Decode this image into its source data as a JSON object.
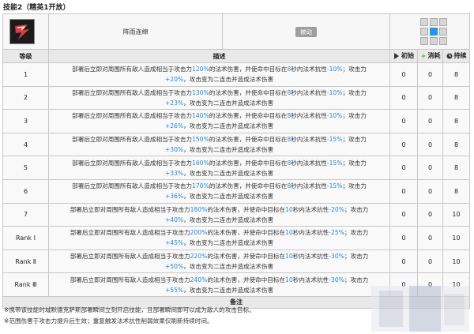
{
  "skill": {
    "heading": "技能2（精英1开放）",
    "name": "阵雨连绵",
    "type_badge": "被动",
    "icon": "skill-icon-storm"
  },
  "columns": {
    "level": "等级",
    "desc": "描述",
    "initial": "初始",
    "cost": "消耗",
    "duration": "持续"
  },
  "rows": [
    {
      "level": "1",
      "pre": "部署后立即对周围所有敌人造成相当于攻击力",
      "pct": "120%",
      "mid": "的法术伤害，并使命中目标在",
      "sec": "8",
      "post": "秒内法术抗性",
      "res": "-10%",
      "tail": "；攻击力",
      "atk": "+20%",
      "line2": "，攻击变为二连击并造成法术伤害",
      "init": "0",
      "cost": "0",
      "dur": "8"
    },
    {
      "level": "2",
      "pre": "部署后立即对周围所有敌人造成相当于攻击力",
      "pct": "130%",
      "mid": "的法术伤害，并使命中目标在",
      "sec": "8",
      "post": "秒内法术抗性",
      "res": "-10%",
      "tail": "；攻击力",
      "atk": "+23%",
      "line2": "，攻击变为二连击并造成法术伤害",
      "init": "0",
      "cost": "0",
      "dur": "8"
    },
    {
      "level": "3",
      "pre": "部署后立即对周围所有敌人造成相当于攻击力",
      "pct": "140%",
      "mid": "的法术伤害，并使命中目标在",
      "sec": "8",
      "post": "秒内法术抗性",
      "res": "-10%",
      "tail": "；攻击力",
      "atk": "+26%",
      "line2": "，攻击变为二连击并造成法术伤害",
      "init": "0",
      "cost": "0",
      "dur": "8"
    },
    {
      "level": "4",
      "pre": "部署后立即对周围所有敌人造成相当于攻击力",
      "pct": "150%",
      "mid": "的法术伤害，并使命中目标在",
      "sec": "8",
      "post": "秒内法术抗性",
      "res": "-15%",
      "tail": "；攻击力",
      "atk": "+30%",
      "line2": "，攻击变为二连击并造成法术伤害",
      "init": "0",
      "cost": "0",
      "dur": "8"
    },
    {
      "level": "5",
      "pre": "部署后立即对周围所有敌人造成相当于攻击力",
      "pct": "160%",
      "mid": "的法术伤害，并使命中目标在",
      "sec": "8",
      "post": "秒内法术抗性",
      "res": "-15%",
      "tail": "；攻击力",
      "atk": "+33%",
      "line2": "，攻击变为二连击并造成法术伤害",
      "init": "0",
      "cost": "0",
      "dur": "8"
    },
    {
      "level": "6",
      "pre": "部署后立即对周围所有敌人造成相当于攻击力",
      "pct": "170%",
      "mid": "的法术伤害，并使命中目标在",
      "sec": "8",
      "post": "秒内法术抗性",
      "res": "-15%",
      "tail": "；攻击力",
      "atk": "+36%",
      "line2": "，攻击变为二连击并造成法术伤害",
      "init": "0",
      "cost": "0",
      "dur": "8"
    },
    {
      "level": "7",
      "pre": "部署后立即对周围所有敌人造成相当于攻击力",
      "pct": "180%",
      "mid": "的法术伤害，并使命中目标在",
      "sec": "10",
      "post": "秒内法术抗性",
      "res": "-20%",
      "tail": "；攻击力",
      "atk": "+40%",
      "line2": "，攻击变为二连击并造成法术伤害",
      "init": "0",
      "cost": "0",
      "dur": "10"
    },
    {
      "level": "Rank Ⅰ",
      "pre": "部署后立即对周围所有敌人造成相当于攻击力",
      "pct": "200%",
      "mid": "的法术伤害，并使命中目标在",
      "sec": "10",
      "post": "秒内法术抗性",
      "res": "-25%",
      "tail": "；攻击力",
      "atk": "+45%",
      "line2": "，攻击变为二连击并造成法术伤害",
      "init": "0",
      "cost": "0",
      "dur": "10"
    },
    {
      "level": "Rank Ⅱ",
      "pre": "部署后立即对周围所有敌人造成相当于攻击力",
      "pct": "220%",
      "mid": "的法术伤害，并使命中目标在",
      "sec": "10",
      "post": "秒内法术抗性",
      "res": "-30%",
      "tail": "；攻击力",
      "atk": "+50%",
      "line2": "，攻击变为二连击并造成法术伤害",
      "init": "0",
      "cost": "0",
      "dur": "10"
    },
    {
      "level": "Rank Ⅲ",
      "pre": "部署后立即对周围所有敌人造成相当于攻击力",
      "pct": "240%",
      "mid": "的法术伤害，并使命中目标在",
      "sec": "10",
      "post": "秒内法术抗性",
      "res": "-30%",
      "tail": "；攻击力",
      "atk": "+55%",
      "line2": "，攻击变为二连击并造成法术伤害",
      "init": "0",
      "cost": "0",
      "dur": "10"
    }
  ],
  "notes": {
    "heading": "备注",
    "lines": [
      "※携带该技能时城默德克萨斯部署瞬间立刻开启技能，且部署瞬间即可以成为敌人的攻击目标。",
      "※范围伤害于攻击力提升后生效；重复触发法术抗性削弱效果仅刷新持续时间。"
    ]
  },
  "colors": {
    "highlight": "#1e88e5",
    "range_self": "#2196f3",
    "range_hit": "#d6d6d6",
    "badge": "#9e9e9e"
  }
}
